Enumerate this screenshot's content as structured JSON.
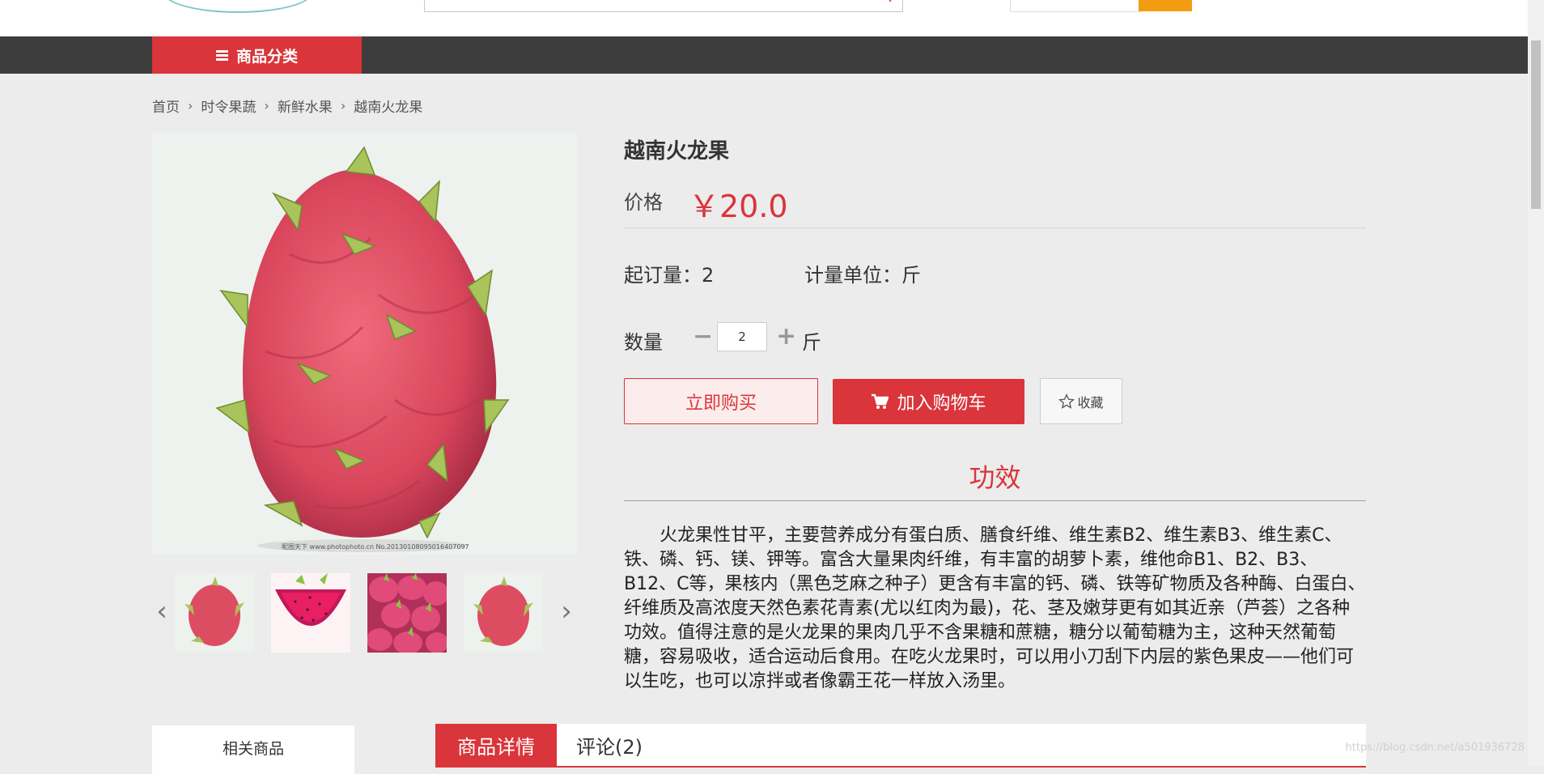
{
  "nav": {
    "category_label": "商品分类"
  },
  "breadcrumb": [
    "首页",
    "时令果蔬",
    "新鲜水果",
    "越南火龙果"
  ],
  "gallery": {
    "caption": "昵图天下 www.photophoto.cn  No.20130108095016407097",
    "thumbnails": [
      "dragon-fruit-whole",
      "dragon-fruit-slice",
      "dragon-fruit-pile",
      "dragon-fruit-whole"
    ]
  },
  "product": {
    "title": "越南火龙果",
    "price_label": "价格",
    "price": "￥20.0",
    "moq": "起订量：2",
    "unit": "计量单位：斤",
    "qty_label": "数量",
    "qty_value": "2",
    "qty_unit": "斤",
    "buy_now": "立即购买",
    "add_to_cart": "加入购物车",
    "favorite": "收藏"
  },
  "effect": {
    "title": "功效",
    "text": "火龙果性甘平，主要营养成分有蛋白质、膳食纤维、维生素B2、维生素B3、维生素C、铁、磷、钙、镁、钾等。富含大量果肉纤维，有丰富的胡萝卜素，维他命B1、B2、B3、B12、C等，果核内（黑色芝麻之种子）更含有丰富的钙、磷、铁等矿物质及各种酶、白蛋白、纤维质及高浓度天然色素花青素(尤以红肉为最)，花、茎及嫩芽更有如其近亲（芦荟）之各种功效。值得注意的是火龙果的果肉几乎不含果糖和蔗糖，糖分以葡萄糖为主，这种天然葡萄糖，容易吸收，适合运动后食用。在吃火龙果时，可以用小刀刮下内层的紫色果皮——他们可以生吃，也可以凉拌或者像霸王花一样放入汤里。"
  },
  "related": {
    "title": "相关商品"
  },
  "tabs": {
    "detail": "商品详情",
    "comments": "评论(2)"
  },
  "watermark": "https://blog.csdn.net/a501936728",
  "colors": {
    "accent": "#d9353b",
    "nav_bg": "#3d3d3d",
    "page_bg": "#ececec"
  }
}
